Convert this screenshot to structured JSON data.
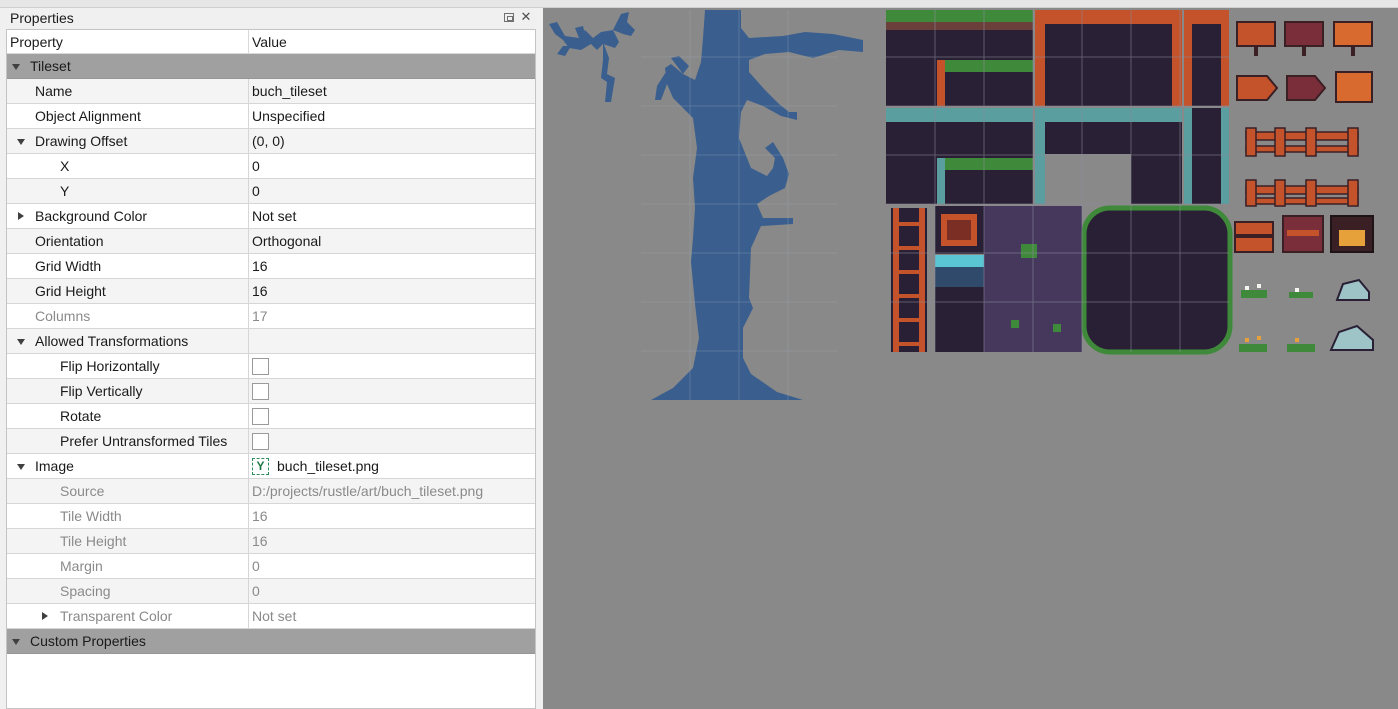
{
  "panel": {
    "title": "Properties"
  },
  "columns": {
    "property": "Property",
    "value": "Value"
  },
  "tileset_group": "Tileset",
  "props": {
    "name": {
      "label": "Name",
      "value": "buch_tileset"
    },
    "object_alignment": {
      "label": "Object Alignment",
      "value": "Unspecified"
    },
    "drawing_offset": {
      "label": "Drawing Offset",
      "value": "(0, 0)"
    },
    "offset_x": {
      "label": "X",
      "value": "0"
    },
    "offset_y": {
      "label": "Y",
      "value": "0"
    },
    "background_color": {
      "label": "Background Color",
      "value": "Not set"
    },
    "orientation": {
      "label": "Orientation",
      "value": "Orthogonal"
    },
    "grid_width": {
      "label": "Grid Width",
      "value": "16"
    },
    "grid_height": {
      "label": "Grid Height",
      "value": "16"
    },
    "columns": {
      "label": "Columns",
      "value": "17"
    },
    "allowed_transformations": {
      "label": "Allowed Transformations",
      "value": ""
    },
    "flip_horizontally": {
      "label": "Flip Horizontally",
      "checked": false
    },
    "flip_vertically": {
      "label": "Flip Vertically",
      "checked": false
    },
    "rotate": {
      "label": "Rotate",
      "checked": false
    },
    "prefer_untransformed": {
      "label": "Prefer Untransformed Tiles",
      "checked": false
    },
    "image": {
      "label": "Image",
      "value": "buch_tileset.png"
    },
    "source": {
      "label": "Source",
      "value": "D:/projects/rustle/art/buch_tileset.png"
    },
    "tile_width": {
      "label": "Tile Width",
      "value": "16"
    },
    "tile_height": {
      "label": "Tile Height",
      "value": "16"
    },
    "margin": {
      "label": "Margin",
      "value": "0"
    },
    "spacing": {
      "label": "Spacing",
      "value": "0"
    },
    "transparent_color": {
      "label": "Transparent Color",
      "value": "Not set"
    }
  },
  "custom_group": "Custom Properties",
  "colors": {
    "canvas_bg": "#898989",
    "tree_blue": "#3a5f8f",
    "dark_tile": "#2a2035",
    "grass": "#3f8a3a",
    "rust": "#c4522a",
    "teal": "#5a9ea0",
    "group_header": "#a0a0a0"
  },
  "icons": {
    "image_file": "tile-image-icon",
    "float": "float-dock-icon",
    "close": "close-icon"
  }
}
